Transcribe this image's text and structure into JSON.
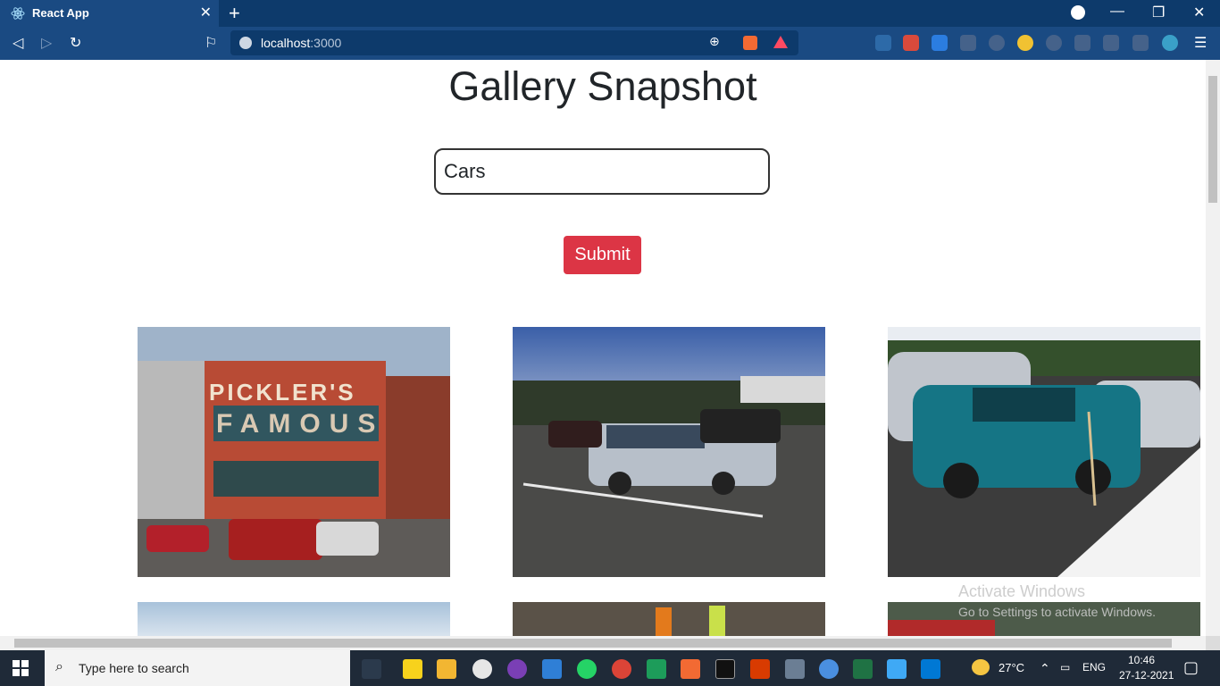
{
  "browser": {
    "tab_title": "React App",
    "url_host": "localhost",
    "url_port": ":3000"
  },
  "page": {
    "heading": "Gallery Snapshot",
    "search_value": "Cars",
    "submit_label": "Submit"
  },
  "gallery": {
    "images": [
      {
        "name": "pickler-famous-storefront-image"
      },
      {
        "name": "silver-wagon-parking-lot-image"
      },
      {
        "name": "teal-sedan-snow-image"
      },
      {
        "name": "sky-image"
      },
      {
        "name": "crowd-race-image"
      },
      {
        "name": "red-car-image"
      }
    ],
    "sign_text": "PICKLER'S",
    "sign_text_2": "FAMOUS"
  },
  "windows_watermark": {
    "title": "Activate Windows",
    "subtitle": "Go to Settings to activate Windows."
  },
  "taskbar": {
    "search_placeholder": "Type here to search",
    "weather": "27°C",
    "language": "ENG",
    "time": "10:46",
    "date": "27-12-2021"
  },
  "colors": {
    "submit_button": "#dc3545",
    "browser_chrome": "#1a4a82"
  }
}
